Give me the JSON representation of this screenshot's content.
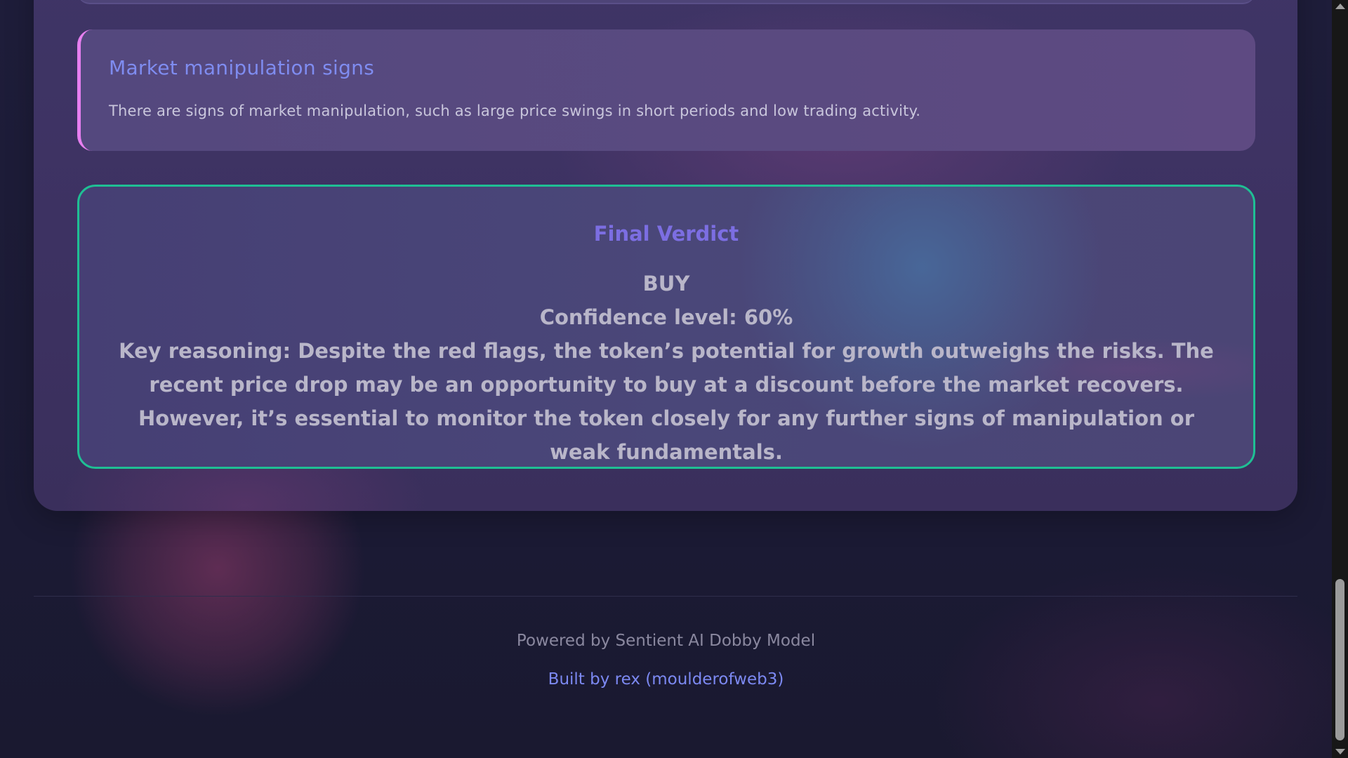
{
  "manipulation": {
    "title": "Market manipulation signs",
    "text": "There are signs of market manipulation, such as large price swings in short periods and low trading activity."
  },
  "verdict": {
    "title": "Final Verdict",
    "decision": "BUY",
    "confidence": "Confidence level: 60%",
    "reasoning": "Key reasoning: Despite the red flags, the token’s potential for growth outweighs the risks. The recent price drop may be an opportunity to buy at a discount before the market recovers. However, it’s essential to monitor the token closely for any further signs of manipulation or weak fundamentals."
  },
  "footer": {
    "powered_by": "Powered by Sentient AI Dobby Model",
    "built_by": "Built by rex (moulderofweb3)"
  },
  "colors": {
    "accent_pink": "#e77ff0",
    "accent_green": "#1fbf94",
    "accent_blue": "#7c89f2",
    "verdict_title": "#7c6ee2"
  },
  "scrollbar": {
    "icons": [
      "scroll-up-arrow-icon",
      "scroll-down-arrow-icon"
    ]
  }
}
